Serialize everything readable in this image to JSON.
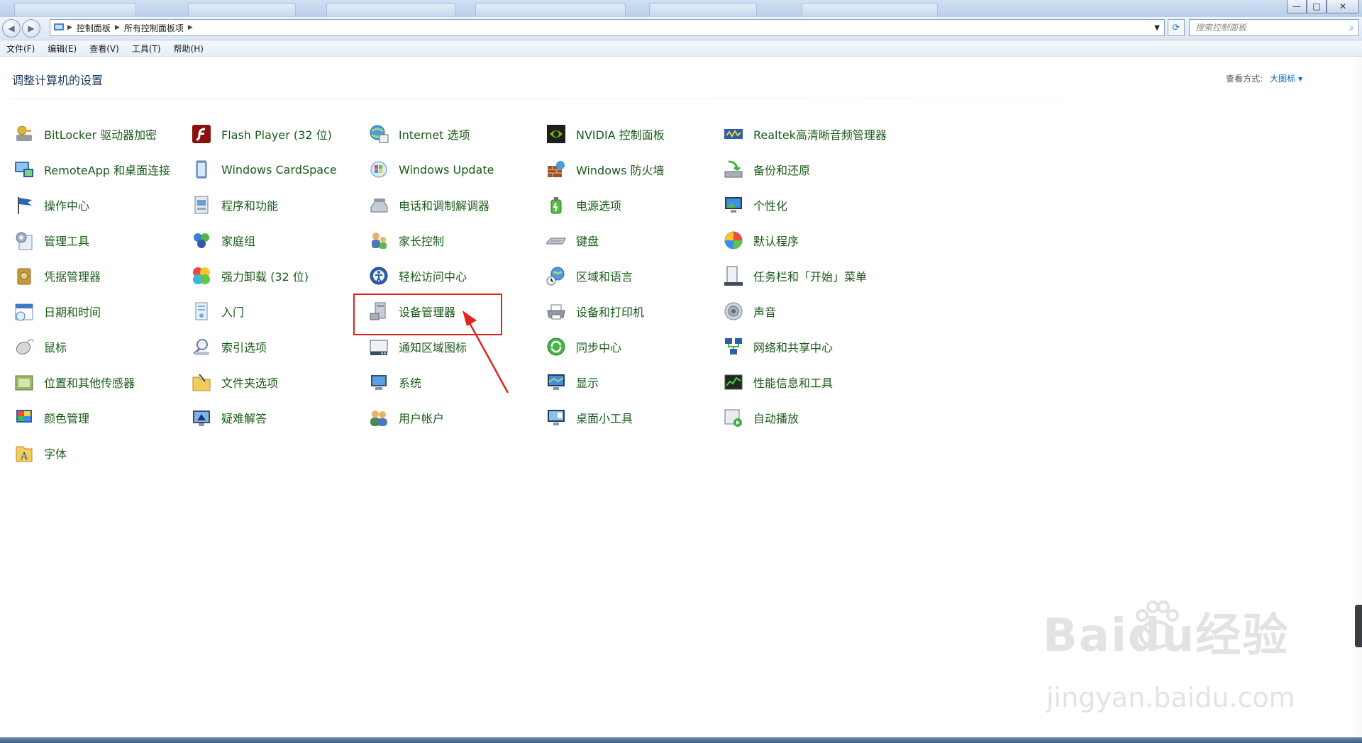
{
  "window": {
    "breadcrumb": [
      "控制面板",
      "所有控制面板项"
    ],
    "search_placeholder": "搜索控制面板",
    "controls": [
      "—",
      "□",
      "✕"
    ]
  },
  "menu": [
    "文件(F)",
    "编辑(E)",
    "查看(V)",
    "工具(T)",
    "帮助(H)"
  ],
  "content": {
    "title": "调整计算机的设置",
    "view_by_label": "查看方式:",
    "view_by_value": "大图标",
    "columns": [
      [
        {
          "label": "BitLocker 驱动器加密",
          "icon": "key-drive-icon"
        },
        {
          "label": "RemoteApp 和桌面连接",
          "icon": "remote-desktop-icon"
        },
        {
          "label": "操作中心",
          "icon": "flag-icon"
        },
        {
          "label": "管理工具",
          "icon": "admin-tools-icon"
        },
        {
          "label": "凭据管理器",
          "icon": "credential-vault-icon"
        },
        {
          "label": "日期和时间",
          "icon": "calendar-clock-icon"
        },
        {
          "label": "鼠标",
          "icon": "mouse-icon"
        },
        {
          "label": "位置和其他传感器",
          "icon": "sensor-icon"
        },
        {
          "label": "颜色管理",
          "icon": "color-management-icon"
        },
        {
          "label": "字体",
          "icon": "font-folder-icon"
        }
      ],
      [
        {
          "label": "Flash Player (32 位)",
          "icon": "flash-player-icon"
        },
        {
          "label": "Windows CardSpace",
          "icon": "cardspace-icon"
        },
        {
          "label": "程序和功能",
          "icon": "programs-icon"
        },
        {
          "label": "家庭组",
          "icon": "homegroup-icon"
        },
        {
          "label": "强力卸载 (32 位)",
          "icon": "clover-icon"
        },
        {
          "label": "入门",
          "icon": "getting-started-icon"
        },
        {
          "label": "索引选项",
          "icon": "magnifier-icon"
        },
        {
          "label": "文件夹选项",
          "icon": "folder-options-icon"
        },
        {
          "label": "疑难解答",
          "icon": "troubleshoot-icon"
        }
      ],
      [
        {
          "label": "Internet 选项",
          "icon": "globe-icon"
        },
        {
          "label": "Windows Update",
          "icon": "windows-update-icon"
        },
        {
          "label": "电话和调制解调器",
          "icon": "phone-modem-icon"
        },
        {
          "label": "家长控制",
          "icon": "parental-controls-icon"
        },
        {
          "label": "轻松访问中心",
          "icon": "ease-of-access-icon"
        },
        {
          "label": "设备管理器",
          "icon": "device-manager-icon"
        },
        {
          "label": "通知区域图标",
          "icon": "notification-area-icon"
        },
        {
          "label": "系统",
          "icon": "system-icon"
        },
        {
          "label": "用户帐户",
          "icon": "user-accounts-icon"
        }
      ],
      [
        {
          "label": "NVIDIA 控制面板",
          "icon": "nvidia-icon"
        },
        {
          "label": "Windows 防火墙",
          "icon": "firewall-icon"
        },
        {
          "label": "电源选项",
          "icon": "power-options-icon"
        },
        {
          "label": "键盘",
          "icon": "keyboard-icon"
        },
        {
          "label": "区域和语言",
          "icon": "region-globe-icon"
        },
        {
          "label": "设备和打印机",
          "icon": "printer-icon"
        },
        {
          "label": "同步中心",
          "icon": "sync-icon"
        },
        {
          "label": "显示",
          "icon": "display-icon"
        },
        {
          "label": "桌面小工具",
          "icon": "gadgets-icon"
        }
      ],
      [
        {
          "label": "Realtek高清晰音频管理器",
          "icon": "realtek-audio-icon"
        },
        {
          "label": "备份和还原",
          "icon": "backup-icon"
        },
        {
          "label": "个性化",
          "icon": "personalization-icon"
        },
        {
          "label": "默认程序",
          "icon": "default-programs-icon"
        },
        {
          "label": "任务栏和「开始」菜单",
          "icon": "taskbar-icon"
        },
        {
          "label": "声音",
          "icon": "speaker-icon"
        },
        {
          "label": "网络和共享中心",
          "icon": "network-icon"
        },
        {
          "label": "性能信息和工具",
          "icon": "performance-icon"
        },
        {
          "label": "自动播放",
          "icon": "autoplay-icon"
        }
      ]
    ]
  },
  "annotation": {
    "color": "#e0231f"
  },
  "watermark": {
    "logo": "Baidu经验",
    "url": "jingyan.baidu.com"
  }
}
